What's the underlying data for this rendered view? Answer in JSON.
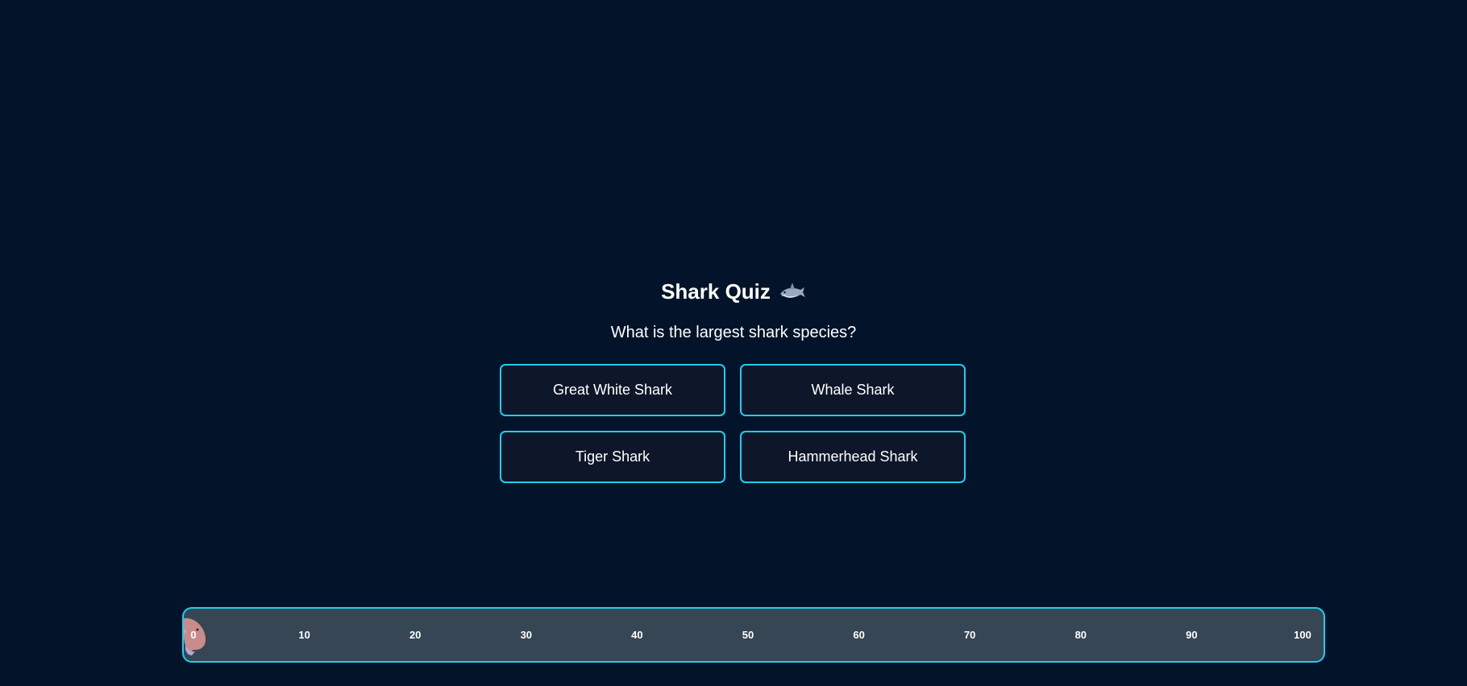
{
  "quiz": {
    "title": "Shark Quiz",
    "title_icon": "shark-emoji",
    "question": "What is the largest shark species?",
    "answers": [
      {
        "label": "Great White Shark"
      },
      {
        "label": "Whale Shark"
      },
      {
        "label": "Tiger Shark"
      },
      {
        "label": "Hammerhead Shark"
      }
    ]
  },
  "progress": {
    "value": 0,
    "max": 100,
    "ticks": [
      "0",
      "10",
      "20",
      "30",
      "40",
      "50",
      "60",
      "70",
      "80",
      "90",
      "100"
    ],
    "runner_icon": "shark-icon"
  },
  "colors": {
    "background": "#03142a",
    "accent": "#1ad0ee",
    "button_bg": "#0e1729",
    "track_bg": "#374654"
  }
}
